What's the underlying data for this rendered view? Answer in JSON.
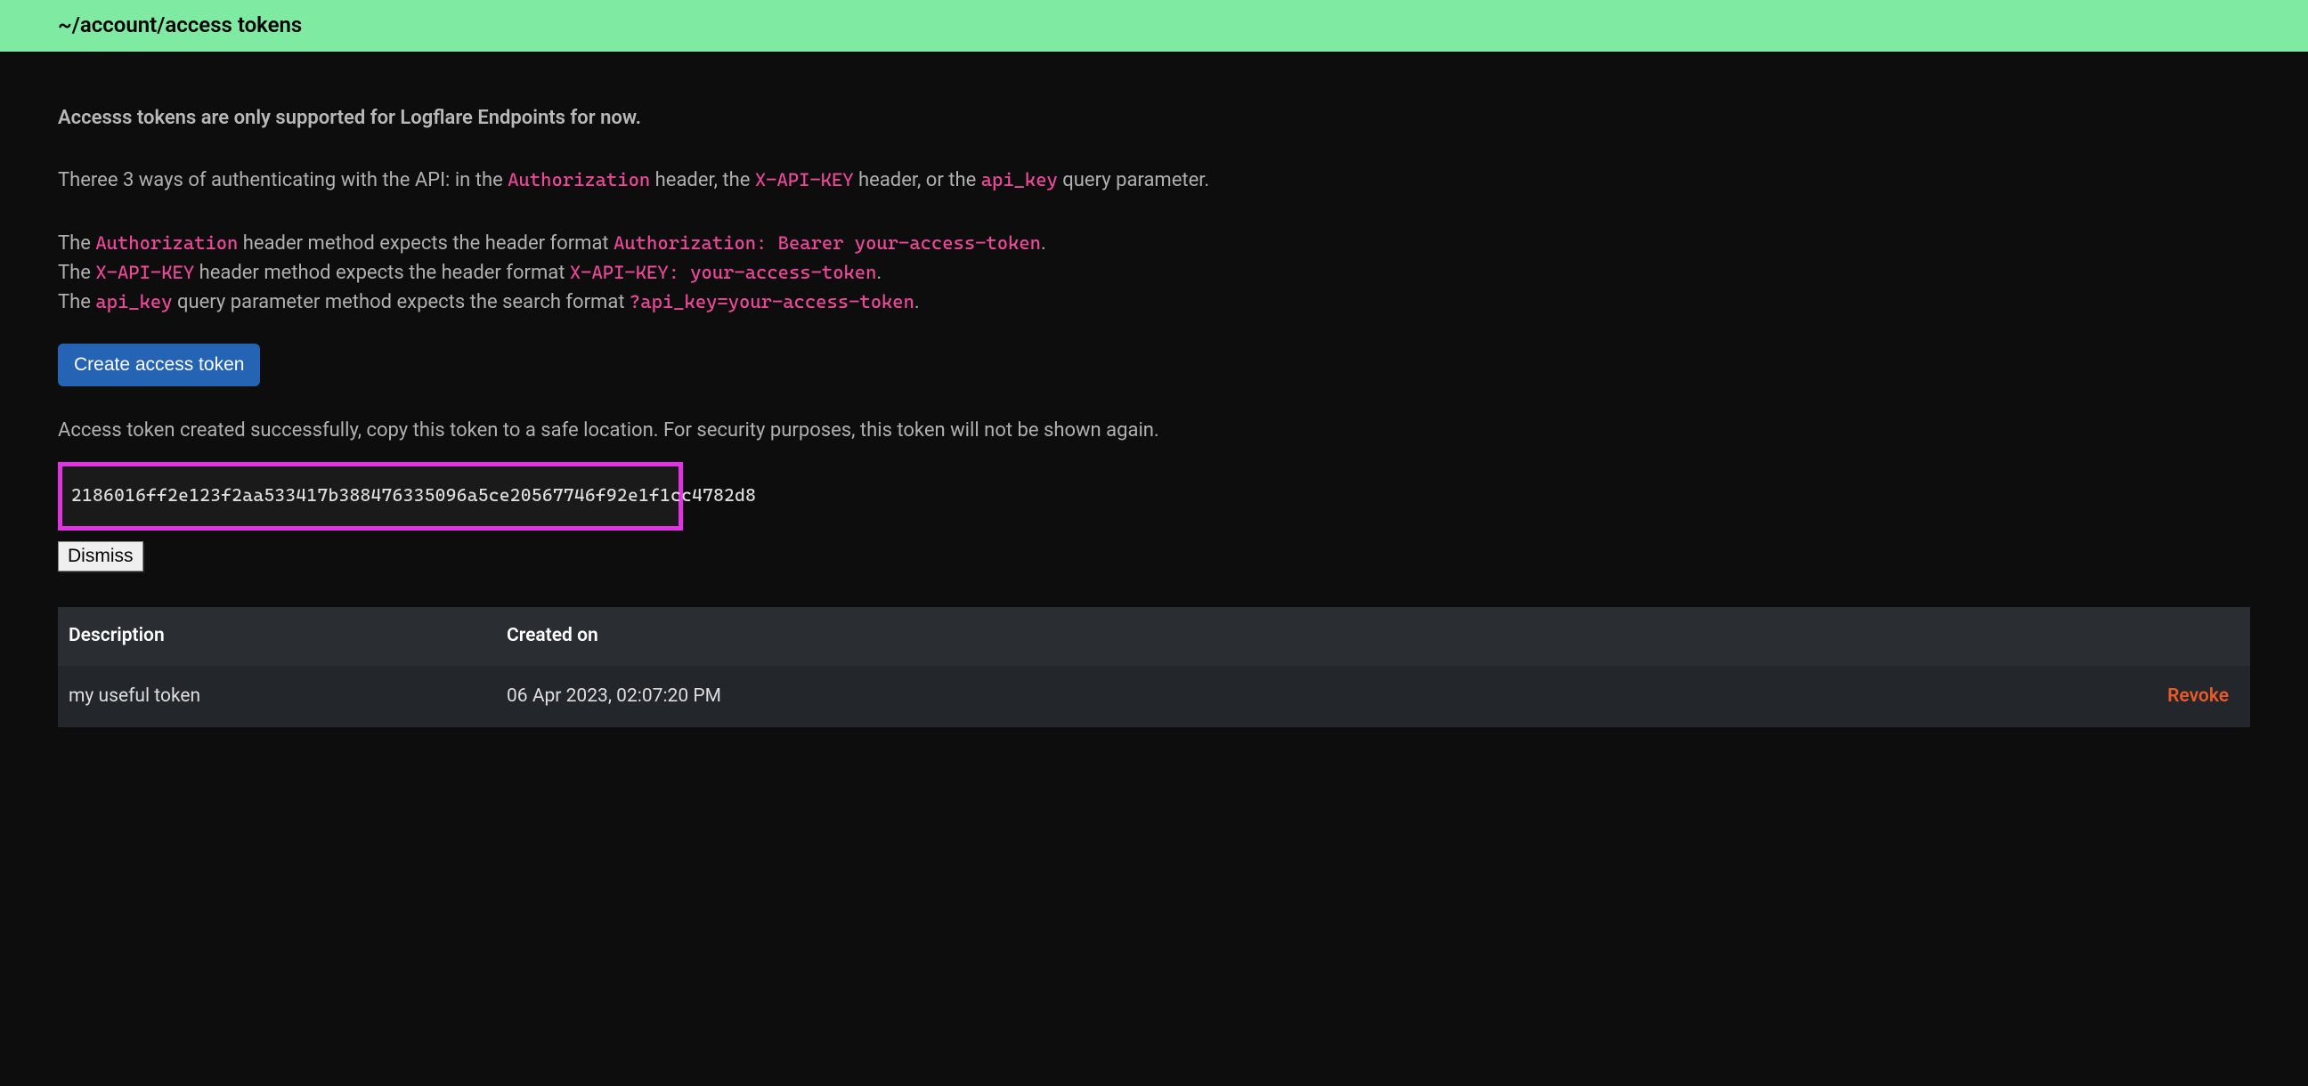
{
  "header": {
    "breadcrumb": "~/account/access tokens"
  },
  "intro": {
    "bold": "Accesss tokens are only supported for Logflare Endpoints for now.",
    "desc_1": "Theree 3 ways of authenticating with the API: in the ",
    "desc_code_1": "Authorization",
    "desc_2": " header, the ",
    "desc_code_2": "X-API-KEY",
    "desc_3": " header, or the ",
    "desc_code_3": "api_key",
    "desc_4": " query parameter."
  },
  "methods": {
    "line1_a": "The ",
    "line1_code1": "Authorization",
    "line1_b": " header method expects the header format ",
    "line1_code2": "Authorization: Bearer your-access-token",
    "line1_c": ".",
    "line2_a": "The ",
    "line2_code1": "X-API-KEY",
    "line2_b": " header method expects the header format ",
    "line2_code2": "X-API-KEY: your-access-token",
    "line2_c": ".",
    "line3_a": "The ",
    "line3_code1": "api_key",
    "line3_b": " query parameter method expects the search format ",
    "line3_code2": "?api_key=your-access-token",
    "line3_c": "."
  },
  "buttons": {
    "create": "Create access token",
    "dismiss": "Dismiss"
  },
  "token_created": {
    "message": "Access token created successfully, copy this token to a safe location. For security purposes, this token will not be shown again.",
    "value": "2186016ff2e123f2aa533417b388476335096a5ce20567746f92e1f1cc4782d8"
  },
  "table": {
    "headers": {
      "description": "Description",
      "created_on": "Created on"
    },
    "rows": [
      {
        "description": "my useful token",
        "created_on": "06 Apr 2023, 02:07:20 PM",
        "action": "Revoke"
      }
    ]
  }
}
